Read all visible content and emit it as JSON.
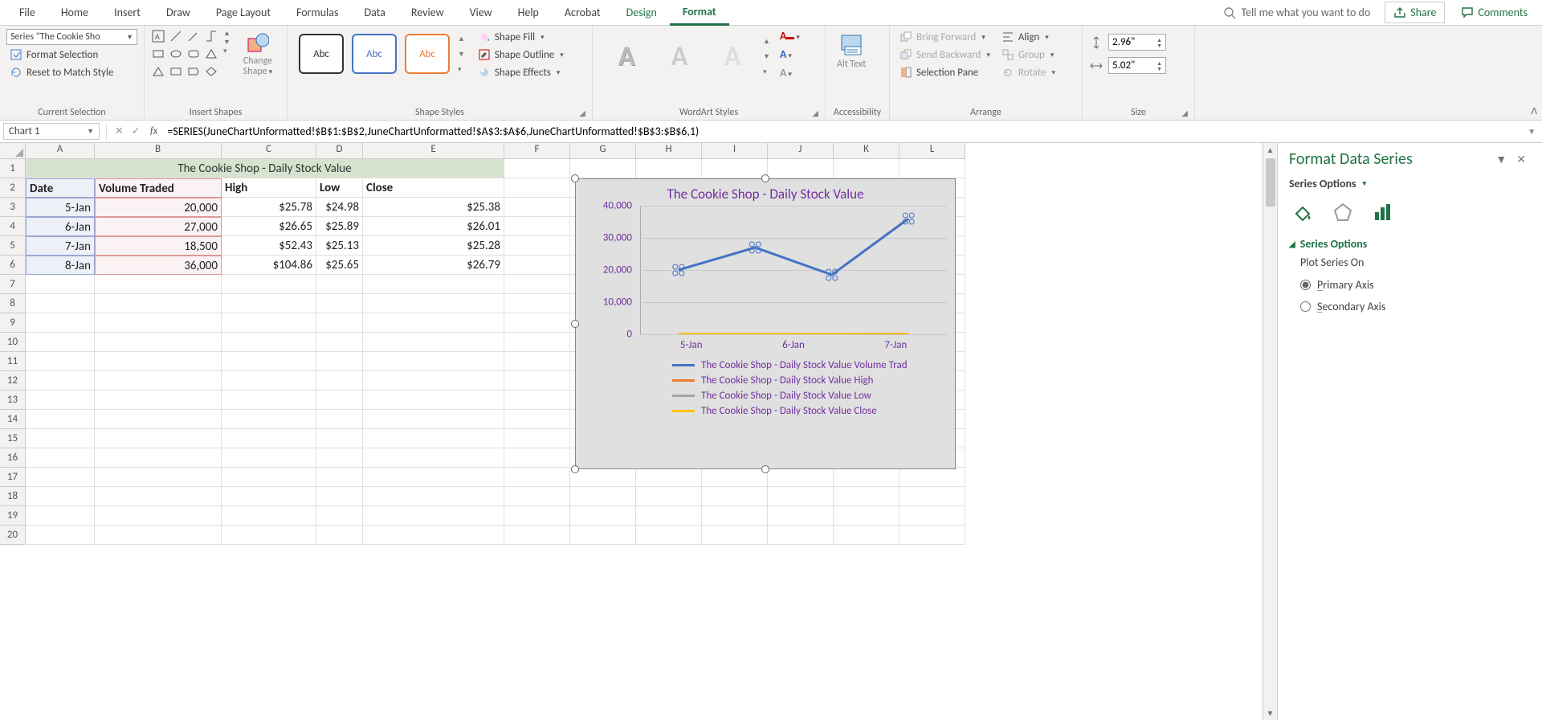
{
  "menubar": {
    "tabs": [
      "File",
      "Home",
      "Insert",
      "Draw",
      "Page Layout",
      "Formulas",
      "Data",
      "Review",
      "View",
      "Help",
      "Acrobat",
      "Design",
      "Format"
    ],
    "active": "Format",
    "contextual_green": [
      "Design",
      "Format"
    ],
    "tellme": "Tell me what you want to do",
    "share": "Share",
    "comments": "Comments"
  },
  "ribbon": {
    "currentSelection": {
      "selector_text": "Series \"The Cookie Sho",
      "format_selection": "Format Selection",
      "reset_match": "Reset to Match Style",
      "label": "Current Selection"
    },
    "insertShapes": {
      "change_shape": "Change Shape",
      "label": "Insert Shapes"
    },
    "shapeStyles": {
      "swatch_text": "Abc",
      "shape_fill": "Shape Fill",
      "shape_outline": "Shape Outline",
      "shape_effects": "Shape Effects",
      "label": "Shape Styles"
    },
    "wordart": {
      "glyph": "A",
      "label": "WordArt Styles"
    },
    "accessibility": {
      "alt_text": "Alt Text",
      "label": "Accessibility"
    },
    "arrange": {
      "bring_forward": "Bring Forward",
      "send_backward": "Send Backward",
      "selection_pane": "Selection Pane",
      "align": "Align",
      "group": "Group",
      "rotate": "Rotate",
      "label": "Arrange"
    },
    "size": {
      "height": "2.96\"",
      "width": "5.02\"",
      "label": "Size"
    }
  },
  "formulaBar": {
    "namebox": "Chart 1",
    "formula": "=SERIES(JuneChartUnformatted!$B$1:$B$2,JuneChartUnformatted!$A$3:$A$6,JuneChartUnformatted!$B$3:$B$6,1)"
  },
  "sheet": {
    "columns": [
      "A",
      "B",
      "C",
      "D",
      "E",
      "F",
      "G",
      "H",
      "I",
      "J",
      "K",
      "L"
    ],
    "title_merged": "The Cookie Shop - Daily Stock Value",
    "headers": {
      "A": "Date",
      "B": "Volume Traded",
      "C": "High",
      "D": "Low",
      "E": "Close"
    },
    "rows": [
      {
        "A": "5-Jan",
        "B": "20,000",
        "C": "$25.78",
        "D": "$24.98",
        "E": "$25.38"
      },
      {
        "A": "6-Jan",
        "B": "27,000",
        "C": "$26.65",
        "D": "$25.89",
        "E": "$26.01"
      },
      {
        "A": "7-Jan",
        "B": "18,500",
        "C": "$52.43",
        "D": "$25.13",
        "E": "$25.28"
      },
      {
        "A": "8-Jan",
        "B": "36,000",
        "C": "$104.86",
        "D": "$25.65",
        "E": "$26.79"
      }
    ]
  },
  "chart_data": {
    "type": "line",
    "title": "The Cookie Shop - Daily Stock Value",
    "categories": [
      "5-Jan",
      "6-Jan",
      "7-Jan",
      "8-Jan"
    ],
    "series": [
      {
        "name": "The Cookie Shop - Daily Stock Value Volume Traded",
        "values": [
          20000,
          27000,
          18500,
          36000
        ],
        "color": "#4472c4"
      },
      {
        "name": "The Cookie Shop - Daily Stock Value High",
        "values": [
          25.78,
          26.65,
          52.43,
          104.86
        ],
        "color": "#ed7d31"
      },
      {
        "name": "The Cookie Shop - Daily Stock Value Low",
        "values": [
          24.98,
          25.89,
          25.13,
          25.65
        ],
        "color": "#a5a5a5"
      },
      {
        "name": "The Cookie Shop - Daily Stock Value Close",
        "values": [
          25.38,
          26.01,
          25.28,
          26.79
        ],
        "color": "#ffc000"
      }
    ],
    "ylim": [
      0,
      40000
    ],
    "yticks": [
      0,
      10000,
      20000,
      30000,
      40000
    ],
    "ytick_labels": [
      "0",
      "10,000",
      "20,000",
      "30,000",
      "40,000"
    ],
    "xlabels_visible": [
      "5-Jan",
      "6-Jan",
      "7-Jan"
    ],
    "legend_labels": [
      "The Cookie Shop - Daily Stock Value Volume Trad",
      "The Cookie Shop - Daily Stock Value High",
      "The Cookie Shop - Daily Stock Value Low",
      "The Cookie Shop - Daily Stock Value Close"
    ],
    "legend_colors": [
      "#4472c4",
      "#ed7d31",
      "#a5a5a5",
      "#ffc000"
    ],
    "selected_series_index": 0
  },
  "taskpane": {
    "title": "Format Data Series",
    "series_options": "Series Options",
    "section": "Series Options",
    "plot_on": "Plot Series On",
    "primary": "Primary Axis",
    "secondary": "Secondary Axis",
    "selected": "primary"
  }
}
